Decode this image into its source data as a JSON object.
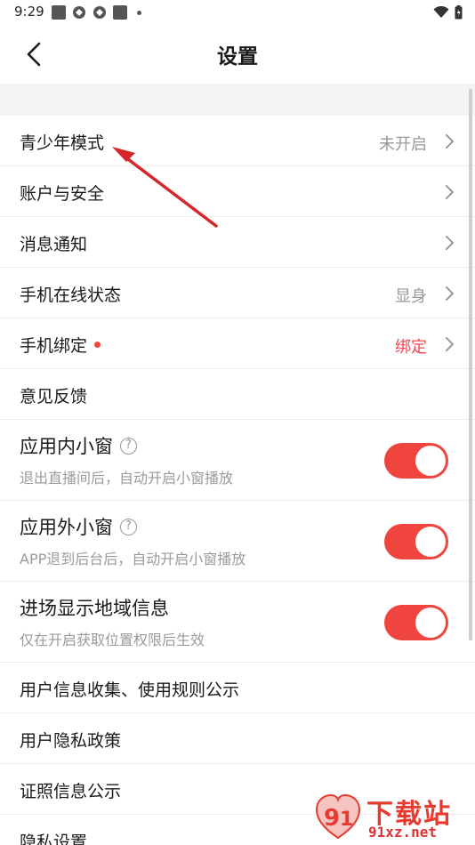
{
  "status": {
    "time": "9:29"
  },
  "header": {
    "title": "设置"
  },
  "menu": {
    "teen_mode": {
      "label": "青少年模式",
      "value": "未开启"
    },
    "account": {
      "label": "账户与安全"
    },
    "notify": {
      "label": "消息通知"
    },
    "online": {
      "label": "手机在线状态",
      "value": "显身"
    },
    "bind": {
      "label": "手机绑定",
      "value": "绑定"
    },
    "feedback": {
      "label": "意见反馈"
    },
    "in_app": {
      "label": "应用内小窗",
      "sub": "退出直播间后，自动开启小窗播放",
      "enabled": true
    },
    "out_app": {
      "label": "应用外小窗",
      "sub": "APP退到后台后，自动开启小窗播放",
      "enabled": true
    },
    "region": {
      "label": "进场显示地域信息",
      "sub": "仅在开启获取位置权限后生效",
      "enabled": true
    },
    "rules": {
      "label": "用户信息收集、使用规则公示"
    },
    "privacy_policy": {
      "label": "用户隐私政策"
    },
    "license": {
      "label": "证照信息公示"
    },
    "privacy_settings": {
      "label": "隐私设置"
    }
  },
  "help_icon_glyph": "?",
  "watermark": {
    "brand": "下载站",
    "url": "91xz.net"
  },
  "colors": {
    "accent": "#f0443e",
    "value_red": "#f04654",
    "muted": "#999999",
    "arrow": "#d7262b"
  }
}
